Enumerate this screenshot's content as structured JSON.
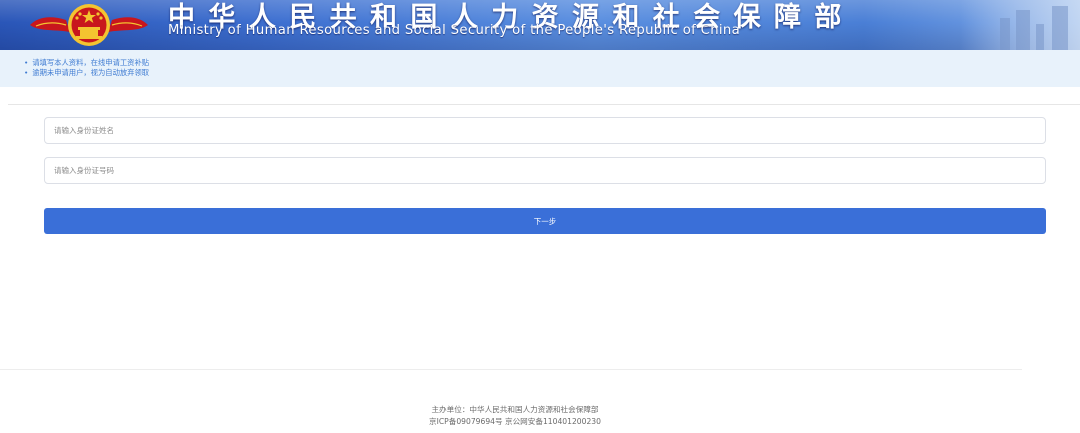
{
  "header": {
    "title_cn": "中华人民共和国人力资源和社会保障部",
    "title_en": "Ministry of Human Resources and Social Security of the People's Republic of China",
    "emblem_icon": "national-emblem-icon",
    "colors": {
      "banner_dark": "#2a56b8",
      "banner_light": "#7fa9e8",
      "emblem_red": "#c8161d",
      "emblem_gold": "#f4c430"
    }
  },
  "notice": {
    "items": [
      "请填写本人资料，在线申请工资补贴",
      "逾期未申请用户，视为自动放弃领取"
    ],
    "color": "#3e7bd2"
  },
  "form": {
    "name_placeholder": "请输入身份证姓名",
    "id_placeholder": "请输入身份证号码",
    "next_label": "下一步",
    "button_color": "#3a6fd8"
  },
  "footer": {
    "sponsor": "主办单位：中华人民共和国人力资源和社会保障部",
    "icp": "京ICP备09079694号 京公网安备110401200230"
  }
}
